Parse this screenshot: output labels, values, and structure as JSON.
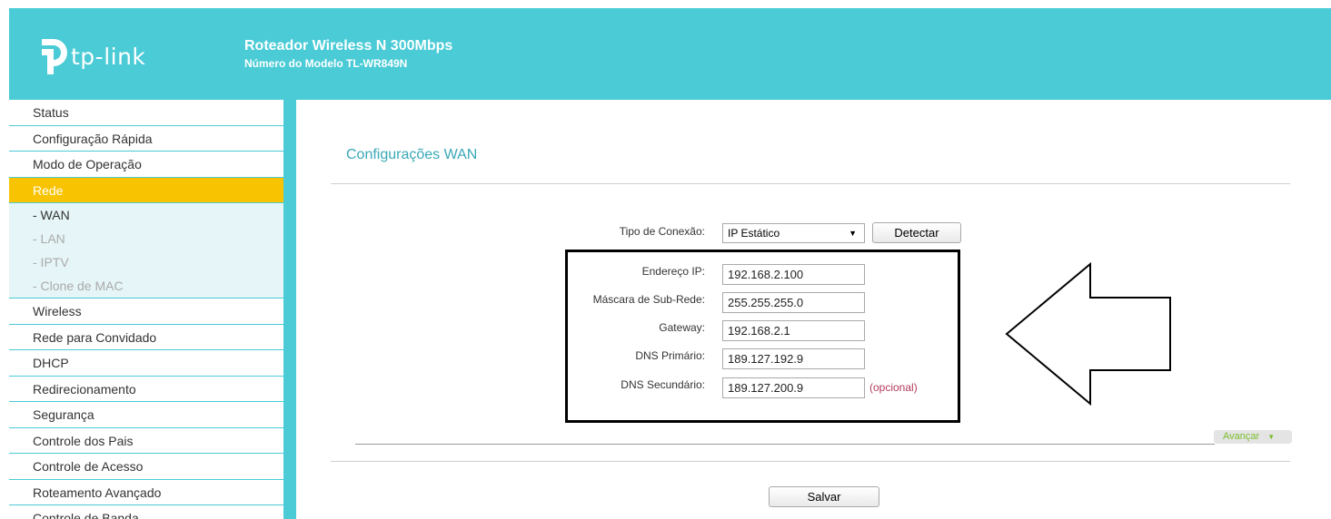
{
  "header": {
    "logo_text": "tp-link",
    "title": "Roteador Wireless N 300Mbps",
    "model": "Número do Modelo TL-WR849N",
    "color": "#4acbd6"
  },
  "sidebar": {
    "items_top": [
      {
        "label": "Status"
      },
      {
        "label": "Configuração Rápida"
      },
      {
        "label": "Modo de Operação"
      }
    ],
    "active_item": {
      "label": "Rede"
    },
    "sub_items": [
      {
        "label": "- WAN"
      },
      {
        "label": "- LAN"
      },
      {
        "label": "- IPTV"
      },
      {
        "label": "- Clone de MAC"
      }
    ],
    "items_bottom": [
      {
        "label": "Wireless"
      },
      {
        "label": "Rede para Convidado"
      },
      {
        "label": "DHCP"
      },
      {
        "label": "Redirecionamento"
      },
      {
        "label": "Segurança"
      },
      {
        "label": "Controle dos Pais"
      },
      {
        "label": "Controle de Acesso"
      },
      {
        "label": "Roteamento Avançado"
      },
      {
        "label": "Controle de Banda"
      }
    ],
    "active_color": "#f8c300"
  },
  "main": {
    "page_title": "Configurações WAN",
    "connection": {
      "label": "Tipo de Conexão:",
      "selected": "IP Estático",
      "detect_button": "Detectar"
    },
    "fields": {
      "ip": {
        "label": "Endereço IP:",
        "value": "192.168.2.100"
      },
      "mask": {
        "label": "Máscara de Sub-Rede:",
        "value": "255.255.255.0"
      },
      "gateway": {
        "label": "Gateway:",
        "value": "192.168.2.1"
      },
      "dns1": {
        "label": "DNS Primário:",
        "value": "189.127.192.9"
      },
      "dns2": {
        "label": "DNS Secundário:",
        "value": "189.127.200.9"
      }
    },
    "optional_note": "(opcional)",
    "advanced_label": "Avançar",
    "save_button": "Salvar"
  }
}
